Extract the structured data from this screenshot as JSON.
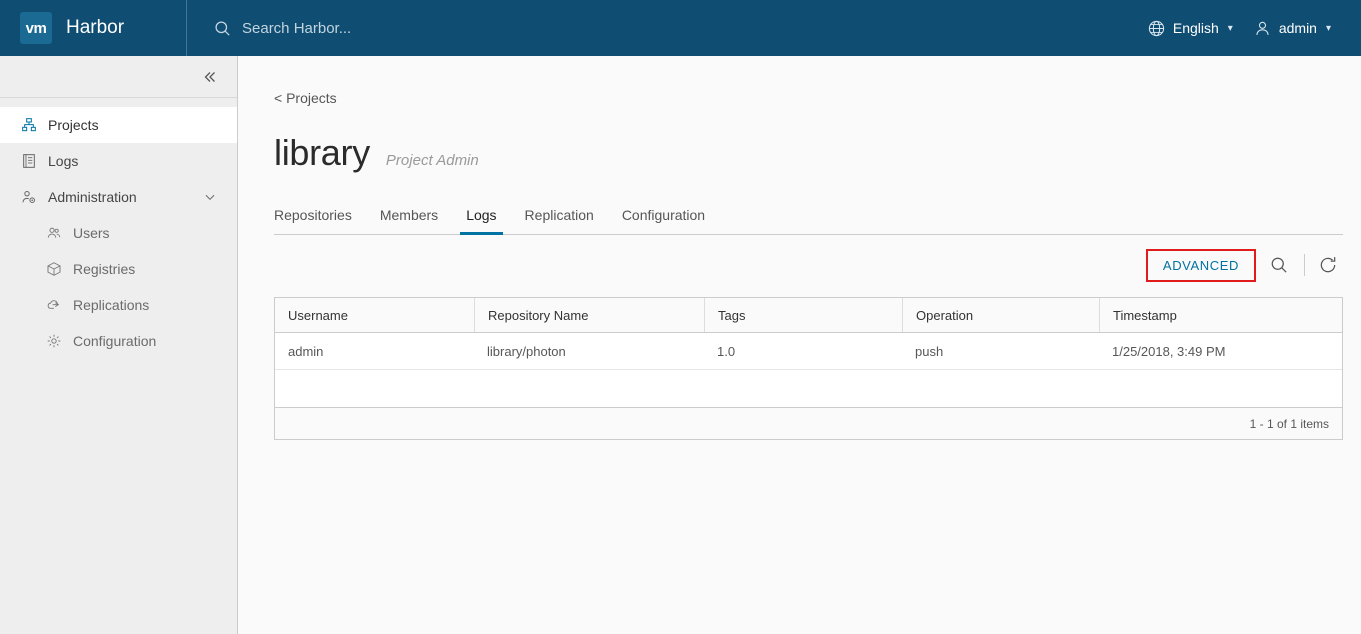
{
  "header": {
    "logo_text": "vm",
    "brand": "Harbor",
    "search_placeholder": "Search Harbor...",
    "language": "English",
    "user": "admin",
    "bg_color": "#0f4d73"
  },
  "sidebar": {
    "collapse_label": "«",
    "items": [
      {
        "label": "Projects",
        "icon": "projects-icon",
        "active": true
      },
      {
        "label": "Logs",
        "icon": "logs-icon",
        "active": false
      },
      {
        "label": "Administration",
        "icon": "administration-icon",
        "active": false,
        "expanded": true
      }
    ],
    "sub_items": [
      {
        "label": "Users",
        "icon": "users-icon"
      },
      {
        "label": "Registries",
        "icon": "registries-icon"
      },
      {
        "label": "Replications",
        "icon": "replications-icon"
      },
      {
        "label": "Configuration",
        "icon": "configuration-icon"
      }
    ]
  },
  "main": {
    "breadcrumb": "< Projects",
    "project_name": "library",
    "project_role": "Project Admin",
    "tabs": [
      {
        "label": "Repositories",
        "active": false
      },
      {
        "label": "Members",
        "active": false
      },
      {
        "label": "Logs",
        "active": true
      },
      {
        "label": "Replication",
        "active": false
      },
      {
        "label": "Configuration",
        "active": false
      }
    ],
    "toolbar": {
      "advanced_label": "ADVANCED",
      "highlight_color": "#e01b1b",
      "accent_color": "#0072a3"
    },
    "table": {
      "columns": [
        "Username",
        "Repository Name",
        "Tags",
        "Operation",
        "Timestamp"
      ],
      "rows": [
        {
          "username": "admin",
          "repository_name": "library/photon",
          "tags": "1.0",
          "operation": "push",
          "timestamp": "1/25/2018, 3:49 PM"
        }
      ],
      "footer": "1 - 1 of 1 items"
    }
  }
}
